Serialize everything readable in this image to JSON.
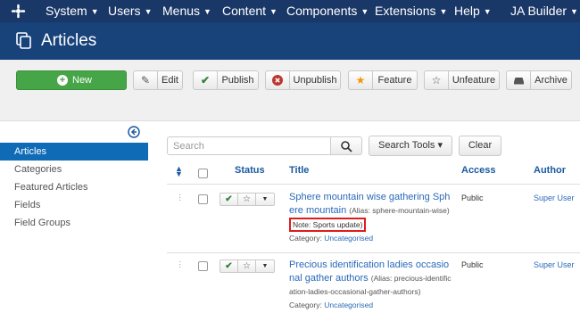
{
  "nav": {
    "items": [
      "System",
      "Users",
      "Menus",
      "Content",
      "Components",
      "Extensions",
      "Help",
      "JA Builder"
    ]
  },
  "header": {
    "title": "Articles"
  },
  "toolbar": {
    "new": "New",
    "edit": "Edit",
    "publish": "Publish",
    "unpublish": "Unpublish",
    "feature": "Feature",
    "unfeature": "Unfeature",
    "archive": "Archive"
  },
  "sidebar": {
    "items": [
      {
        "label": "Articles",
        "active": true
      },
      {
        "label": "Categories",
        "active": false
      },
      {
        "label": "Featured Articles",
        "active": false
      },
      {
        "label": "Fields",
        "active": false
      },
      {
        "label": "Field Groups",
        "active": false
      }
    ]
  },
  "search": {
    "placeholder": "Search",
    "tools_label": "Search Tools ▾",
    "clear_label": "Clear"
  },
  "table": {
    "headers": {
      "status": "Status",
      "title": "Title",
      "access": "Access",
      "author": "Author"
    },
    "rows": [
      {
        "title": "Sphere mountain wise gathering Sphere mountain",
        "alias": "(Alias: sphere-mountain-wise)",
        "note": "Note: Sports update)",
        "category_prefix": "Category:",
        "category": "Uncategorised",
        "access": "Public",
        "author": "Super User"
      },
      {
        "title": "Precious identification ladies occasional gather authors",
        "alias": "(Alias: precious-identification-ladies-occasional-gather-authors)",
        "category_prefix": "Category:",
        "category": "Uncategorised",
        "access": "Public",
        "author": "Super User"
      }
    ]
  },
  "colors": {
    "topnav": "#1a3867",
    "header": "#17427a",
    "new_button": "#46a546",
    "active_sidebar": "#0f6bb6",
    "link": "#2a69b8",
    "note_highlight": "#e01b1b"
  }
}
